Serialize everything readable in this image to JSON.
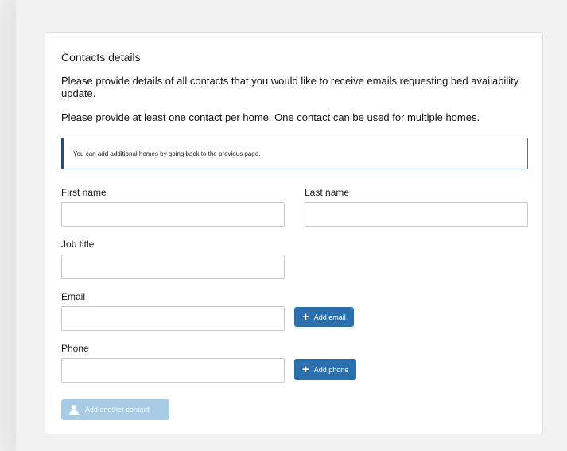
{
  "section": {
    "title": "Contacts details",
    "intro": "Please provide details of all contacts that you would like to receive emails requesting bed availability update.",
    "requirement": "Please provide at least one contact per home. One contact can be used for multiple homes."
  },
  "notice": {
    "text": "You can add additional homes by going back to the previous page."
  },
  "form": {
    "first_name": {
      "label": "First name",
      "value": "",
      "placeholder": ""
    },
    "last_name": {
      "label": "Last name",
      "value": "",
      "placeholder": ""
    },
    "job_title": {
      "label": "Job title",
      "value": "",
      "placeholder": ""
    },
    "email": {
      "label": "Email",
      "value": "",
      "placeholder": ""
    },
    "phone": {
      "label": "Phone",
      "value": "",
      "placeholder": ""
    }
  },
  "buttons": {
    "add_email": "Add email",
    "add_phone": "Add phone",
    "add_contact": "Add another contact"
  },
  "icons": {
    "add_email": "plus-icon",
    "add_phone": "plus-icon",
    "add_contact": "person-icon"
  },
  "colors": {
    "primary_button": "#2c6fad",
    "disabled_button": "#a8cce6",
    "notice_border": "#1f4e8c"
  }
}
